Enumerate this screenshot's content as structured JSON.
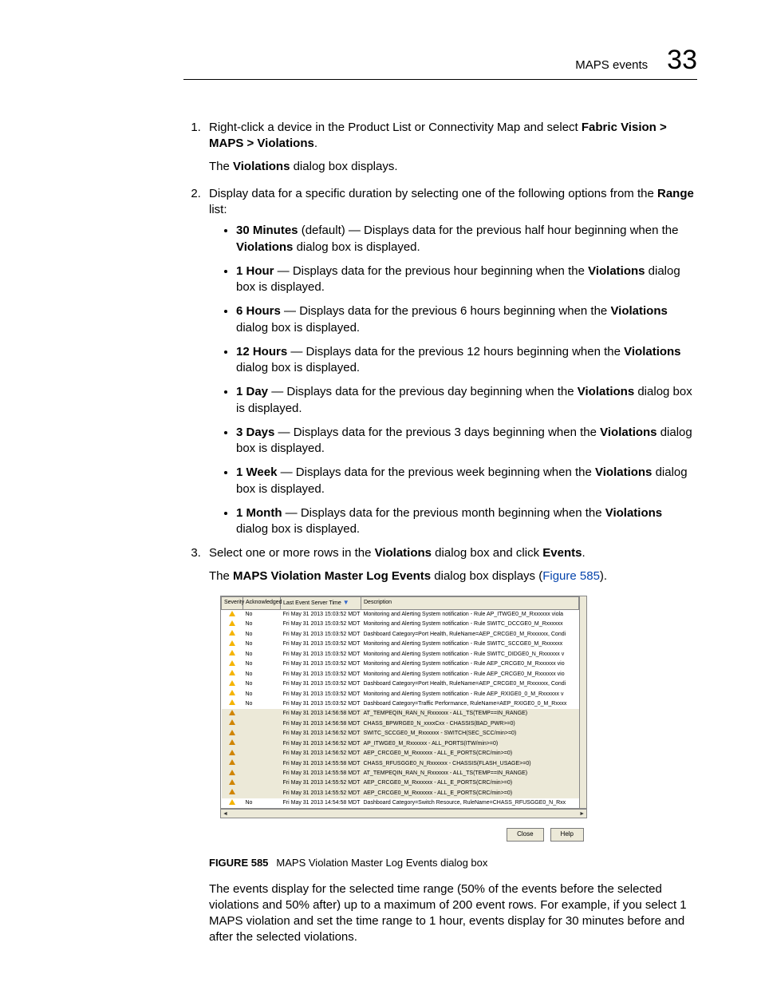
{
  "header": {
    "title": "MAPS events",
    "chapter": "33"
  },
  "step1": {
    "lead": "Right-click a device in the Product List or Connectivity Map and select ",
    "bold": "Fabric Vision > MAPS > Violations",
    "tail": "."
  },
  "p1a": "The ",
  "p1b": "Violations",
  "p1c": " dialog box displays.",
  "step2": {
    "a": "Display data for a specific duration by selecting one of the following options from the ",
    "b": "Range",
    "c": " list:"
  },
  "opts": [
    {
      "label": "30 Minutes",
      "suffix": " (default) — Displays data for the previous half hour beginning when the ",
      "dlg": "Violations",
      "tail": " dialog box is displayed."
    },
    {
      "label": "1 Hour",
      "suffix": " — Displays data for the previous hour beginning when the ",
      "dlg": "Violations",
      "tail": " dialog box is displayed."
    },
    {
      "label": "6 Hours",
      "suffix": " — Displays data for the previous 6 hours beginning when the ",
      "dlg": "Violations",
      "tail": " dialog box is displayed."
    },
    {
      "label": "12 Hours",
      "suffix": " — Displays data for the previous 12 hours beginning when the ",
      "dlg": "Violations",
      "tail": " dialog box is displayed."
    },
    {
      "label": "1 Day",
      "suffix": " — Displays data for the previous day beginning when the ",
      "dlg": "Violations",
      "tail": " dialog box is displayed."
    },
    {
      "label": "3 Days",
      "suffix": " — Displays data for the previous 3 days beginning when the ",
      "dlg": "Violations",
      "tail": " dialog box is displayed."
    },
    {
      "label": "1 Week",
      "suffix": " — Displays data for the previous week beginning when the ",
      "dlg": "Violations",
      "tail": " dialog box is displayed."
    },
    {
      "label": "1 Month",
      "suffix": " — Displays data for the previous month beginning when the ",
      "dlg": "Violations",
      "tail": " dialog box is displayed."
    }
  ],
  "step3": {
    "a": "Select one or more rows in the ",
    "b": "Violations",
    "c": " dialog box and click ",
    "d": "Events",
    "e": "."
  },
  "p3a": "The ",
  "p3b": "MAPS Violation Master Log Events",
  "p3c": " dialog box displays (",
  "p3link": "Figure 585",
  "p3d": ").",
  "dlg": {
    "headers": {
      "sev": "Severity",
      "ack": "Acknowledged",
      "time": "Last Event Server Time",
      "desc": "Description"
    },
    "rows": [
      {
        "ack": "No",
        "time": "Fri May 31 2013 15:03:52 MDT",
        "desc": "Monitoring and Alerting System notification - Rule AP_ITWGE0_M_Rxxxxxx viola",
        "dark": false
      },
      {
        "ack": "No",
        "time": "Fri May 31 2013 15:03:52 MDT",
        "desc": "Monitoring and Alerting System notification - Rule SWITC_DCCGE0_M_Rxxxxxx",
        "dark": false
      },
      {
        "ack": "No",
        "time": "Fri May 31 2013 15:03:52 MDT",
        "desc": "Dashboard Category=Port Health, RuleName=AEP_CRCGE0_M_Rxxxxxx, Condi",
        "dark": false
      },
      {
        "ack": "No",
        "time": "Fri May 31 2013 15:03:52 MDT",
        "desc": "Monitoring and Alerting System notification - Rule SWITC_SCCGE0_M_Rxxxxxx",
        "dark": false
      },
      {
        "ack": "No",
        "time": "Fri May 31 2013 15:03:52 MDT",
        "desc": "Monitoring and Alerting System notification - Rule SWITC_DIDGE0_N_Rxxxxxx v",
        "dark": false
      },
      {
        "ack": "No",
        "time": "Fri May 31 2013 15:03:52 MDT",
        "desc": "Monitoring and Alerting System notification - Rule AEP_CRCGE0_M_Rxxxxxx vio",
        "dark": false
      },
      {
        "ack": "No",
        "time": "Fri May 31 2013 15:03:52 MDT",
        "desc": "Monitoring and Alerting System notification - Rule AEP_CRCGE0_M_Rxxxxxx vio",
        "dark": false
      },
      {
        "ack": "No",
        "time": "Fri May 31 2013 15:03:52 MDT",
        "desc": "Dashboard Category=Port Health, RuleName=AEP_CRCGE0_M_Rxxxxxx, Condi",
        "dark": false
      },
      {
        "ack": "No",
        "time": "Fri May 31 2013 15:03:52 MDT",
        "desc": "Monitoring and Alerting System notification - Rule AEP_RXIGE0_0_M_Rxxxxxx v",
        "dark": false
      },
      {
        "ack": "No",
        "time": "Fri May 31 2013 15:03:52 MDT",
        "desc": "Dashboard Category=Traffic Performance, RuleName=AEP_RXIGE0_0_M_Rxxxx",
        "dark": false
      },
      {
        "ack": "",
        "time": "Fri May 31 2013 14:56:58 MDT",
        "desc": "AT_TEMPEQIN_RAN_N_Rxxxxxx - ALL_TS(TEMP==IN_RANGE)",
        "dark": true
      },
      {
        "ack": "",
        "time": "Fri May 31 2013 14:56:58 MDT",
        "desc": "CHASS_BPWRGE0_N_xxxxCxx - CHASSIS(BAD_PWR>=0)",
        "dark": true
      },
      {
        "ack": "",
        "time": "Fri May 31 2013 14:56:52 MDT",
        "desc": "SWITC_SCCGE0_M_Rxxxxxx - SWITCH(SEC_SCC/min>=0)",
        "dark": true
      },
      {
        "ack": "",
        "time": "Fri May 31 2013 14:56:52 MDT",
        "desc": "AP_ITWGE0_M_Rxxxxxx - ALL_PORTS(ITW/min>=0)",
        "dark": true
      },
      {
        "ack": "",
        "time": "Fri May 31 2013 14:56:52 MDT",
        "desc": "AEP_CRCGE0_M_Rxxxxxx - ALL_E_PORTS(CRC/min>=0)",
        "dark": true
      },
      {
        "ack": "",
        "time": "Fri May 31 2013 14:55:58 MDT",
        "desc": "CHASS_RFUSGGE0_N_Rxxxxxx - CHASSIS(FLASH_USAGE>=0)",
        "dark": true
      },
      {
        "ack": "",
        "time": "Fri May 31 2013 14:55:58 MDT",
        "desc": "AT_TEMPEQIN_RAN_N_Rxxxxxx - ALL_TS(TEMP==IN_RANGE)",
        "dark": true
      },
      {
        "ack": "",
        "time": "Fri May 31 2013 14:55:52 MDT",
        "desc": "AEP_CRCGE0_M_Rxxxxxx - ALL_E_PORTS(CRC/min>=0)",
        "dark": true
      },
      {
        "ack": "",
        "time": "Fri May 31 2013 14:55:52 MDT",
        "desc": "AEP_CRCGE0_M_Rxxxxxx - ALL_E_PORTS(CRC/min>=0)",
        "dark": true
      },
      {
        "ack": "No",
        "time": "Fri May 31 2013 14:54:58 MDT",
        "desc": "Dashboard Category=Switch Resource, RuleName=CHASS_RFUSGGE0_N_Rxx",
        "dark": false
      }
    ],
    "buttons": {
      "close": "Close",
      "help": "Help"
    }
  },
  "figcaption": {
    "num": "FIGURE 585",
    "text": "MAPS Violation Master Log Events dialog box"
  },
  "bodytext": "The events display for the selected time range (50% of the events before the selected violations and 50% after) up to a maximum of 200 event rows. For example, if you select 1 MAPS violation and set the time range to 1 hour, events display for 30 minutes before and after the selected violations."
}
